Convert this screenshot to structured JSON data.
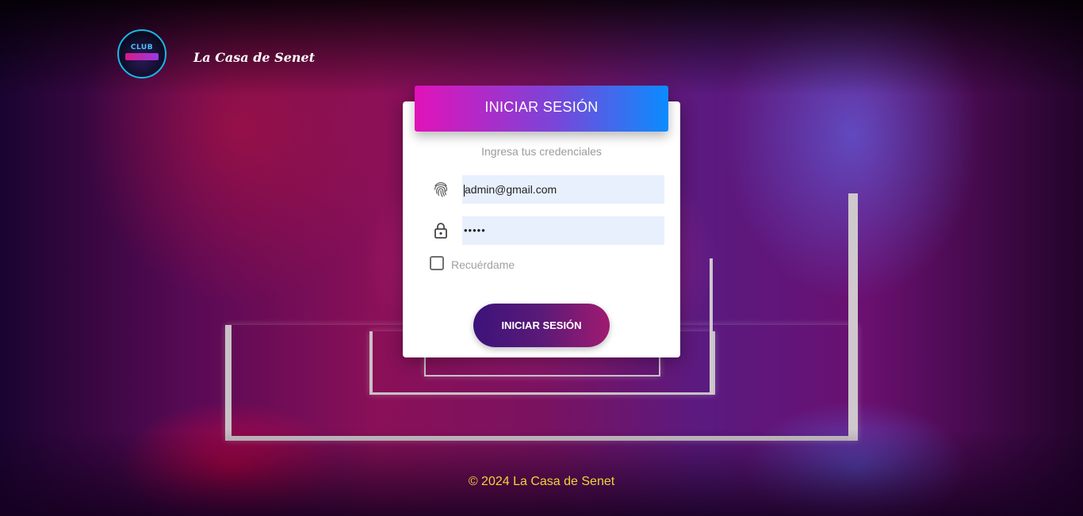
{
  "header": {
    "logo_text": "CLUB",
    "brand_name": "La Casa de Senet"
  },
  "login": {
    "title": "INICIAR SESIÓN",
    "subtitle": "Ingresa tus credenciales",
    "email": {
      "value": "admin@gmail.com",
      "icon": "fingerprint-icon"
    },
    "password": {
      "value": "•••••",
      "icon": "lock-icon"
    },
    "remember_label": "Recuérdame",
    "remember_checked": false,
    "submit_label": "INICIAR SESIÓN"
  },
  "footer": {
    "text": "© 2024 La Casa de Senet"
  },
  "colors": {
    "header_gradient_start": "#e112b9",
    "header_gradient_end": "#0b8cff",
    "button_gradient_start": "#3c137a",
    "button_gradient_end": "#a01a70",
    "footer_text": "#f3d23a",
    "input_bg": "#e8f0fe"
  }
}
